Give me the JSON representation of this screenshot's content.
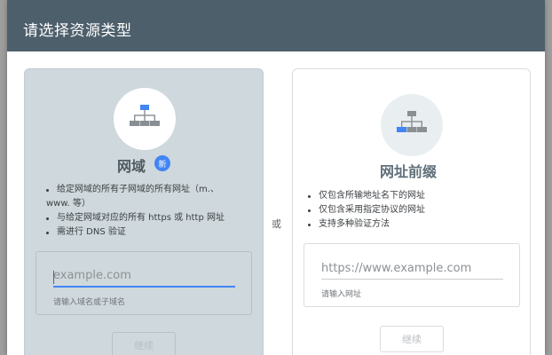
{
  "dialog": {
    "title": "请选择资源类型",
    "or_label": "或"
  },
  "domain_card": {
    "icon": "sitemap-icon",
    "title": "网域",
    "badge": "新",
    "bullets": [
      "给定网域的所有子网域的所有网址（m.、",
      "www. 等）",
      "与给定网域对应的所有 https 或 http 网址",
      "需进行 DNS 验证"
    ],
    "input": {
      "value": "",
      "placeholder": "example.com"
    },
    "helper": "请输入域名或子域名",
    "button": "继续"
  },
  "prefix_card": {
    "icon": "sitemap-icon",
    "title": "网址前缀",
    "bullets": [
      "仅包含所输地址名下的网址",
      "仅包含采用指定协议的网址",
      "支持多种验证方法"
    ],
    "input": {
      "value": "",
      "placeholder": "https://www.example.com"
    },
    "helper": "请输入网址",
    "button": "继续"
  },
  "colors": {
    "header": "#4d5f6b",
    "domain_card_bg": "#cfd8dc",
    "accent": "#4285f4"
  }
}
